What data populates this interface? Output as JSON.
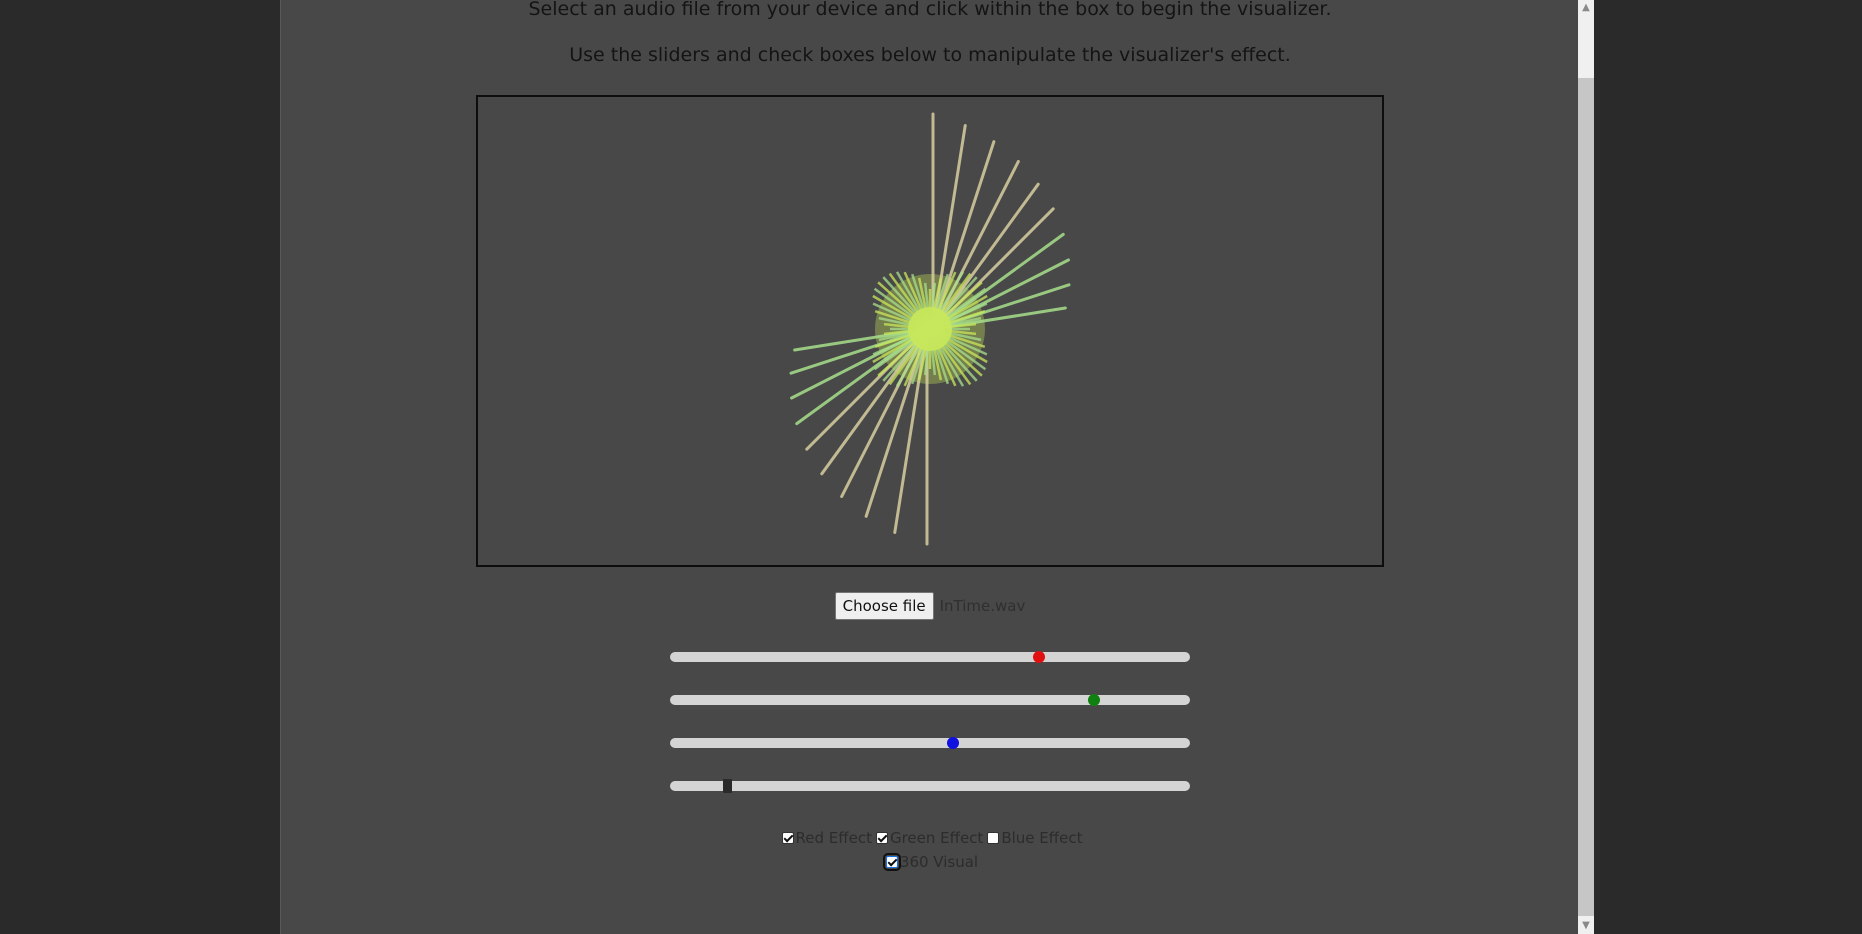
{
  "intro": {
    "line1": "Select an audio file from your device and click within the box to begin the visualizer.",
    "line2": "Use the sliders and check boxes below to manipulate the visualizer's effect."
  },
  "file_input": {
    "button_label": "Choose file",
    "file_name": "InTime.wav"
  },
  "sliders": [
    {
      "name": "red",
      "value": 0.71,
      "thumb_color": "#e01010"
    },
    {
      "name": "green",
      "value": 0.815,
      "thumb_color": "#108010"
    },
    {
      "name": "blue",
      "value": 0.545,
      "thumb_color": "#1010e0"
    },
    {
      "name": "fourth",
      "value": 0.11,
      "thumb_color": "#2a2a2a"
    }
  ],
  "checkboxes": [
    {
      "label": "Red Effect",
      "checked": true
    },
    {
      "label": "Green Effect",
      "checked": true
    },
    {
      "label": "Blue Effect",
      "checked": false
    },
    {
      "label": "360 Visual",
      "checked": true,
      "focused": true
    }
  ],
  "colors": {
    "page_bg": "#484848",
    "outer_bg": "#2a2a2a",
    "ray_tan": "#d8cfa0",
    "ray_green": "#a8e08c",
    "center": "#c8e85a"
  }
}
